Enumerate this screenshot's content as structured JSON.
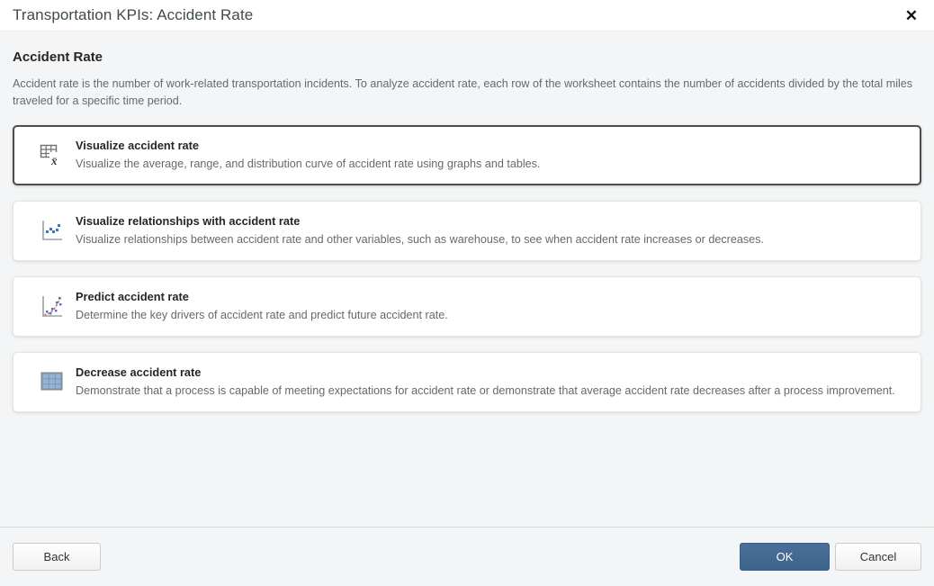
{
  "dialog": {
    "title": "Transportation KPIs: Accident Rate",
    "close_glyph": "✕"
  },
  "intro": {
    "heading": "Accident Rate",
    "description": "Accident rate is the number of work-related transportation incidents. To analyze accident rate, each row of the worksheet contains the number of accidents divided by the total miles traveled for a specific time period."
  },
  "options": [
    {
      "icon": "table-mean-icon",
      "title": "Visualize accident rate",
      "description": "Visualize the average, range, and distribution curve of accident rate using graphs and tables.",
      "selected": true
    },
    {
      "icon": "scatter-plot-icon",
      "title": "Visualize relationships with accident rate",
      "description": "Visualize relationships between accident rate and other variables, such as warehouse, to see when accident rate increases or decreases.",
      "selected": false
    },
    {
      "icon": "trend-curve-icon",
      "title": "Predict accident rate",
      "description": "Determine the key drivers of accident rate and predict future accident rate.",
      "selected": false
    },
    {
      "icon": "capability-table-icon",
      "title": "Decrease accident rate",
      "description": "Demonstrate that a process is capable of meeting expectations for accident rate or demonstrate that average accident rate decreases after a process improvement.",
      "selected": false
    }
  ],
  "footer": {
    "back_label": "Back",
    "ok_label": "OK",
    "cancel_label": "Cancel"
  },
  "colors": {
    "accent_blue": "#44688f",
    "selected_border": "#4d4d4d",
    "body_background": "#f4f5f6",
    "scatter_dot_blue": "#3a78c2",
    "trend_line_red": "#e07a73"
  }
}
